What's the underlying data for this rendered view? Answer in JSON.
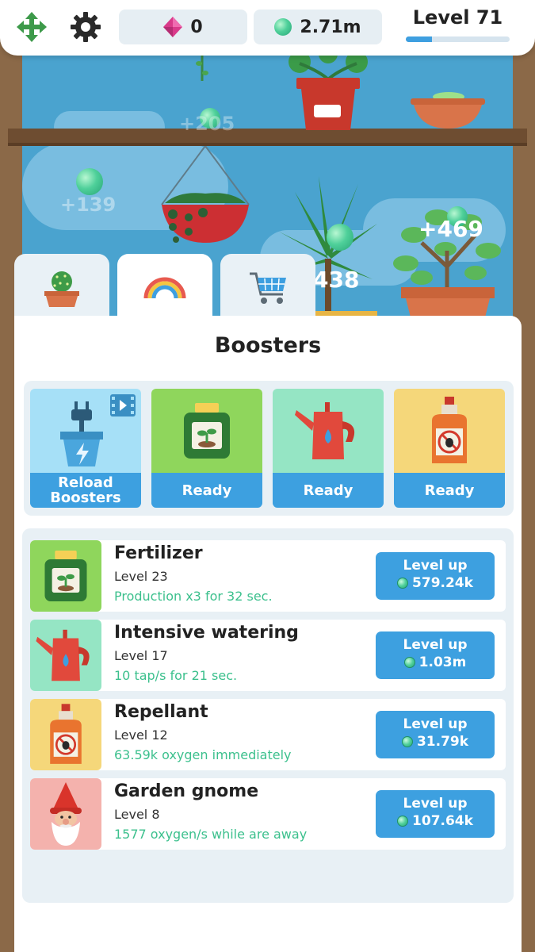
{
  "topbar": {
    "move_icon": "move-arrows-icon",
    "settings_icon": "gear-icon",
    "gems": {
      "icon": "gem-icon",
      "value": "0"
    },
    "oxygen": {
      "icon": "oxygen-orb-icon",
      "value": "2.71m"
    },
    "level": {
      "label": "Level 71",
      "progress": 0.25
    }
  },
  "scene": {
    "floating_numbers": [
      "+205",
      "+139",
      "+469",
      "438"
    ]
  },
  "tabs": [
    {
      "icon": "cactus-icon",
      "active": false
    },
    {
      "icon": "rainbow-icon",
      "active": true
    },
    {
      "icon": "shopping-cart-icon",
      "active": false
    }
  ],
  "panel": {
    "title": "Boosters",
    "quick_boosters": [
      {
        "icon": "plug-pot-icon",
        "label": "Reload Boosters",
        "badge_icon": "video-icon",
        "color": "#a6e0f7"
      },
      {
        "icon": "fertilizer-icon",
        "label": "Ready",
        "color": "#8fd65c"
      },
      {
        "icon": "watering-can-icon",
        "label": "Ready",
        "color": "#95e5c4"
      },
      {
        "icon": "repellant-icon",
        "label": "Ready",
        "color": "#f5d77a"
      }
    ],
    "upgrades": [
      {
        "name": "Fertilizer",
        "level": "Level 23",
        "desc": "Production x3 for 32 sec.",
        "button": "Level up",
        "cost": "579.24k",
        "icon": "fertilizer-icon",
        "color": "#8fd65c"
      },
      {
        "name": "Intensive watering",
        "level": "Level 17",
        "desc": "10 tap/s for 21 sec.",
        "button": "Level up",
        "cost": "1.03m",
        "icon": "watering-can-icon",
        "color": "#95e5c4"
      },
      {
        "name": "Repellant",
        "level": "Level 12",
        "desc": "63.59k oxygen immediately",
        "button": "Level up",
        "cost": "31.79k",
        "icon": "repellant-icon",
        "color": "#f5d77a"
      },
      {
        "name": "Garden gnome",
        "level": "Level 8",
        "desc": "1577 oxygen/s while are away",
        "button": "Level up",
        "cost": "107.64k",
        "icon": "gnome-icon",
        "color": "#f4b2ad"
      }
    ]
  },
  "colors": {
    "accent": "#3da0e0",
    "desc_green": "#3cc08d",
    "sky": "#4aa3cf",
    "wood": "#8b6948"
  }
}
